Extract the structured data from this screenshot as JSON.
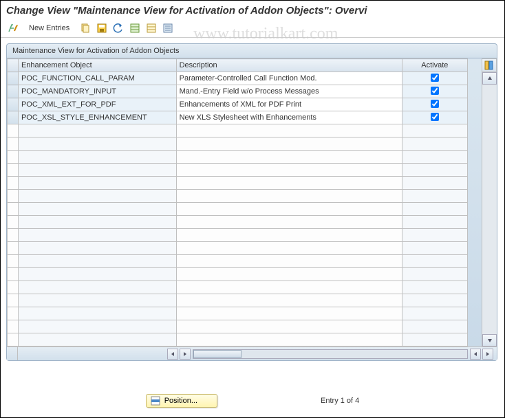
{
  "title": "Change View \"Maintenance View for Activation of Addon Objects\": Overvi",
  "watermark": "www.tutorialkart.com",
  "toolbar": {
    "new_entries_label": "New Entries"
  },
  "panel": {
    "header": "Maintenance View for Activation of Addon Objects",
    "columns": {
      "obj": "Enhancement Object",
      "desc": "Description",
      "activate": "Activate"
    },
    "rows": [
      {
        "obj": "POC_FUNCTION_CALL_PARAM",
        "desc": "Parameter-Controlled Call Function Mod.",
        "activate": true
      },
      {
        "obj": "POC_MANDATORY_INPUT",
        "desc": "Mand.-Entry Field w/o Process Messages",
        "activate": true
      },
      {
        "obj": "POC_XML_EXT_FOR_PDF",
        "desc": "Enhancements of XML for PDF Print",
        "activate": true
      },
      {
        "obj": "POC_XSL_STYLE_ENHANCEMENT",
        "desc": "New XLS Stylesheet with Enhancements",
        "activate": true
      }
    ],
    "empty_row_count": 17
  },
  "footer": {
    "position_label": "Position...",
    "entry_status": "Entry 1 of 4"
  }
}
